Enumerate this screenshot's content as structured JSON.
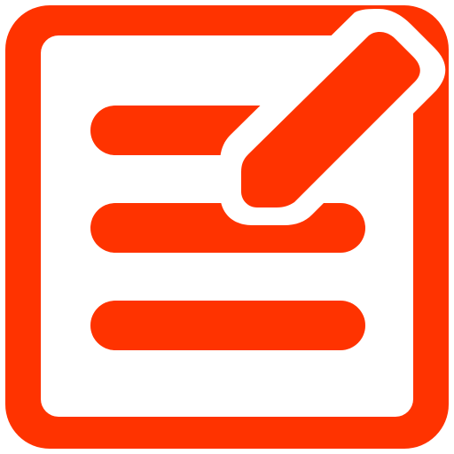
{
  "icon": {
    "name": "edit-note-icon",
    "colors": {
      "primary": "#FF3300",
      "background": "#FFFFFF"
    },
    "line_count": 3
  }
}
